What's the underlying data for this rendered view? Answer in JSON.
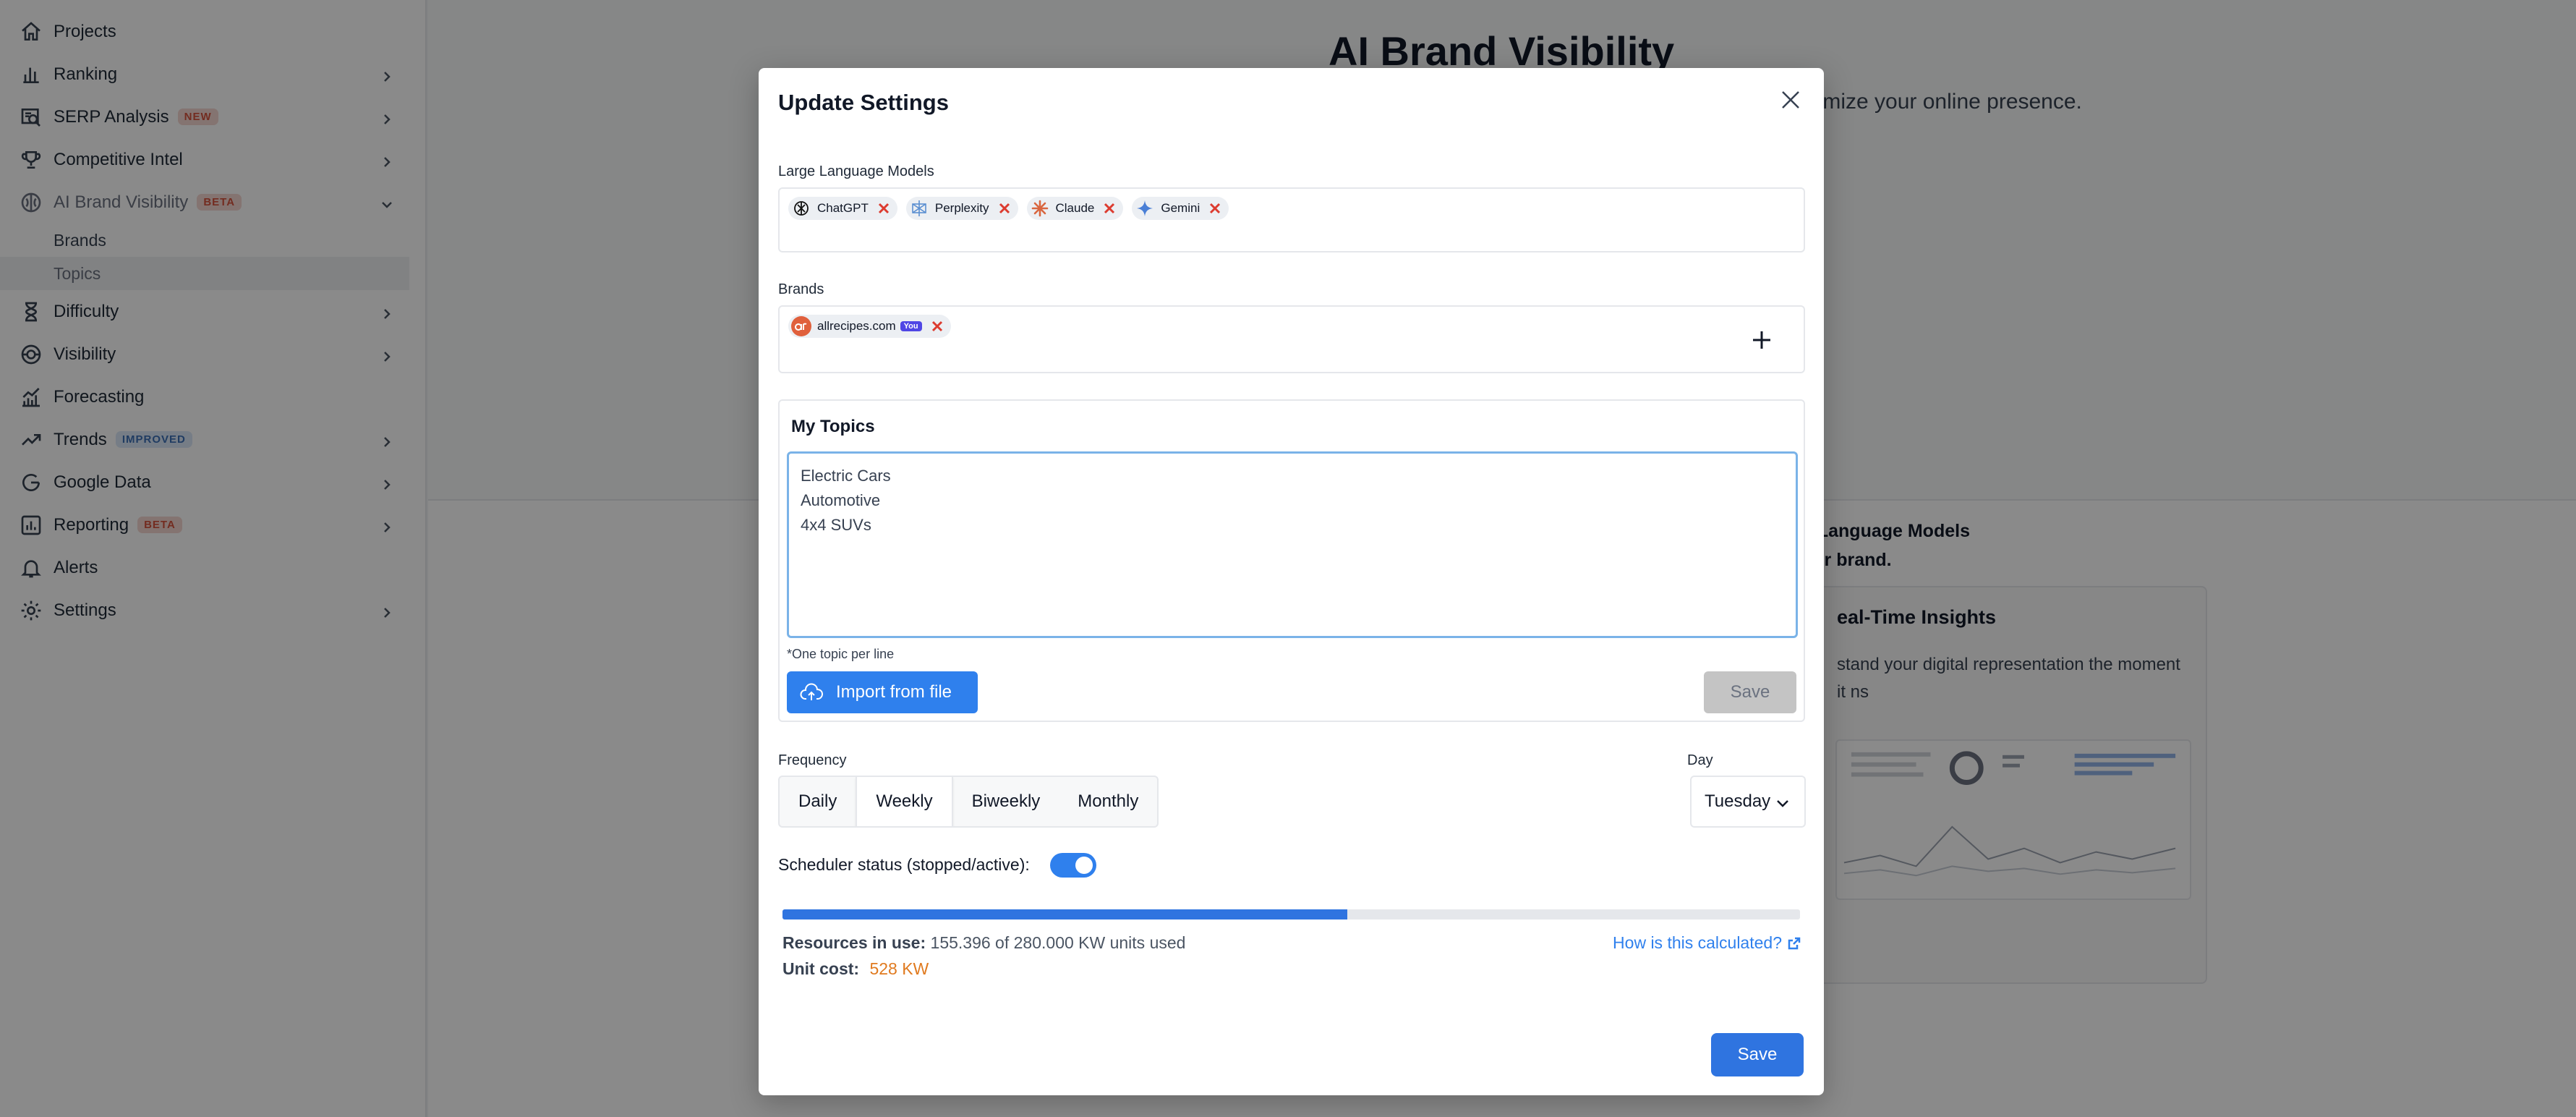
{
  "sidebar": {
    "items": [
      {
        "label": "Projects",
        "icon": "home-icon"
      },
      {
        "label": "Ranking",
        "icon": "bar-chart-icon"
      },
      {
        "label": "SERP Analysis",
        "icon": "serp-icon",
        "badge": "NEW"
      },
      {
        "label": "Competitive Intel",
        "icon": "trophy-icon"
      },
      {
        "label": "AI Brand Visibility",
        "icon": "ai-brand-icon",
        "badge": "BETA"
      },
      {
        "label": "Difficulty",
        "icon": "hourglass-icon"
      },
      {
        "label": "Visibility",
        "icon": "visibility-icon"
      },
      {
        "label": "Forecasting",
        "icon": "forecast-icon"
      },
      {
        "label": "Trends",
        "icon": "trend-icon",
        "badge": "IMPROVED"
      },
      {
        "label": "Google Data",
        "icon": "google-icon"
      },
      {
        "label": "Reporting",
        "icon": "report-icon",
        "badge": "BETA"
      },
      {
        "label": "Alerts",
        "icon": "bell-icon"
      },
      {
        "label": "Settings",
        "icon": "gear-icon"
      }
    ],
    "subitems": [
      {
        "label": "Brands"
      },
      {
        "label": "Topics"
      }
    ]
  },
  "main": {
    "title": "AI Brand Visibility",
    "subtitle": "optimize your online presence.",
    "llm_line1": "e Language Models",
    "llm_line2": "our brand.",
    "card_title": "eal-Time Insights",
    "card_text": "stand your digital representation the moment it ns"
  },
  "modal": {
    "title": "Update Settings",
    "llm_label": "Large Language Models",
    "llms": [
      {
        "name": "ChatGPT",
        "icon": "chatgpt-icon"
      },
      {
        "name": "Perplexity",
        "icon": "perplexity-icon"
      },
      {
        "name": "Claude",
        "icon": "claude-icon"
      },
      {
        "name": "Gemini",
        "icon": "gemini-icon"
      }
    ],
    "brands_label": "Brands",
    "brands": [
      {
        "name": "allrecipes.com",
        "tag": "You",
        "icon": "allrecipes-logo-icon"
      }
    ],
    "topics": {
      "title": "My Topics",
      "value": "Electric Cars\nAutomotive\n4x4 SUVs",
      "hint": "*One topic per line",
      "import_label": "Import from file",
      "save_label": "Save"
    },
    "frequency": {
      "label": "Frequency",
      "options": [
        "Daily",
        "Weekly",
        "Biweekly",
        "Monthly"
      ],
      "selected": "Weekly"
    },
    "day": {
      "label": "Day",
      "value": "Tuesday"
    },
    "scheduler": {
      "label": "Scheduler status (stopped/active):",
      "active": true
    },
    "resources": {
      "label": "Resources in use:",
      "text": "155.396 of 280.000 KW units used",
      "used": 155.396,
      "total": 280.0,
      "cost_label": "Unit cost:",
      "cost_value": "528 KW",
      "link": "How is this calculated?"
    },
    "save_label": "Save"
  },
  "colors": {
    "accent": "#2f80ed",
    "cost": "#e07a1f",
    "remove": "#dc3b2f"
  }
}
